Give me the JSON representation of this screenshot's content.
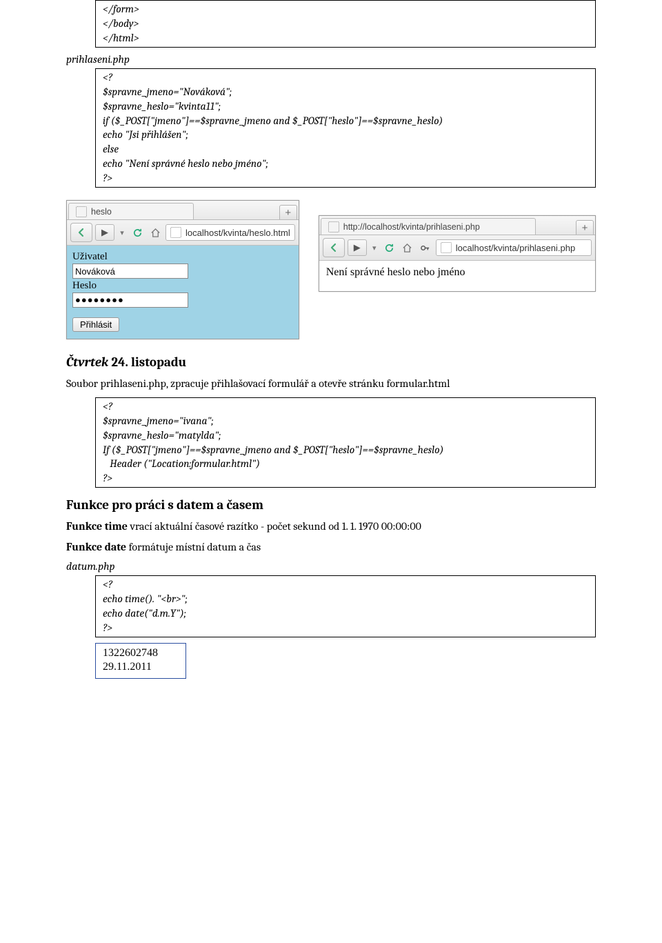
{
  "codebox1": {
    "l1": "</form>",
    "l2": "</body>",
    "l3": "</html>"
  },
  "label_prihlaseni": "prihlaseni.php",
  "codebox2": {
    "l1": "<?",
    "l2": "$spravne_jmeno=\"Nováková\";",
    "l3": "$spravne_heslo=\"kvinta11\";",
    "l4": "",
    "l5": "if ($_POST[\"jmeno\"]==$spravne_jmeno and $_POST[\"heslo\"]==$spravne_heslo)",
    "l6": "echo \"Jsi přihlášen\";",
    "l7": "else",
    "l8": "echo \"Není správné heslo nebo jméno\";",
    "l9": "?>"
  },
  "browser_left": {
    "tab": "heslo",
    "url": "localhost/kvinta/heslo.html",
    "lbl_user": "Uživatel",
    "val_user": "Nováková",
    "lbl_pass": "Heslo",
    "val_pass": "●●●●●●●●",
    "submit": "Přihlásit"
  },
  "browser_right": {
    "tab": "http://localhost/kvinta/prihlaseni.php",
    "url": "localhost/kvinta/prihlaseni.php",
    "body": "Není správné heslo nebo jméno"
  },
  "heading_ctvrtek": {
    "ital": "Čtvrtek",
    "rest": " 24. listopadu"
  },
  "para_soubor": "Soubor prihlaseni.php, zpracuje přihlašovací formulář a otevře stránku formular.html",
  "codebox3": {
    "l1": "<?",
    "l2": "$spravne_jmeno=\"ivana\";",
    "l3": "$spravne_heslo=\"matylda\";",
    "l4": "",
    "l5": "If ($_POST[\"jmeno\"]==$spravne_jmeno and $_POST[\"heslo\"]==$spravne_heslo)",
    "l6": "   Header (\"Location:formular.html\")",
    "l7": "?>"
  },
  "heading_funkce": "Funkce pro práci s datem a časem",
  "para_time": {
    "b": "Funkce time",
    "rest": " vrací aktuální časové razítko - počet sekund od 1. 1. 1970 00:00:00"
  },
  "para_date": {
    "b": "Funkce date",
    "rest": " formátuje místní datum a čas"
  },
  "label_datum": "datum.php",
  "codebox4": {
    "l1": "<?",
    "l2": "echo time(). \"<br>\";",
    "l3": "echo date(\"d.m.Y\");",
    "l4": "?>"
  },
  "resultbox": {
    "l1": "1322602748",
    "l2": "29.11.2011"
  }
}
